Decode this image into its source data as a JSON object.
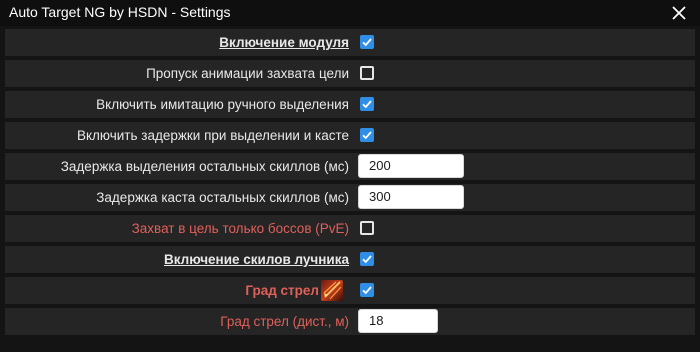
{
  "window": {
    "title": "Auto Target NG by HSDN - Settings",
    "close_icon": "close-icon"
  },
  "colors": {
    "accent": "#2f8fe6",
    "warning_text": "#e0605a",
    "row_bg": "#252525",
    "window_bg": "#141414"
  },
  "settings": {
    "module_enable": {
      "label": "Включение модуля",
      "checked": true
    },
    "skip_capture_animation": {
      "label": "Пропуск анимации захвата цели",
      "checked": false
    },
    "manual_selection_imitation": {
      "label": "Включить имитацию ручного выделения",
      "checked": true
    },
    "selection_cast_delays": {
      "label": "Включить задержки при выделении и касте",
      "checked": true
    },
    "selection_delay_other": {
      "label": "Задержка выделения остальных скиллов (мс)",
      "value": "200"
    },
    "cast_delay_other": {
      "label": "Задержка каста остальных скиллов (мс)",
      "value": "300"
    },
    "target_bosses_only": {
      "label": "Захват в цель только боссов (PvE)",
      "checked": false
    },
    "archer_skills_enable": {
      "label": "Включение скилов лучника",
      "checked": true
    },
    "arrow_rain": {
      "label": "Град стрел",
      "checked": true,
      "icon": "arrow-rain-skill-icon"
    },
    "arrow_rain_distance": {
      "label": "Град стрел (дист., м)",
      "value": "18"
    }
  }
}
